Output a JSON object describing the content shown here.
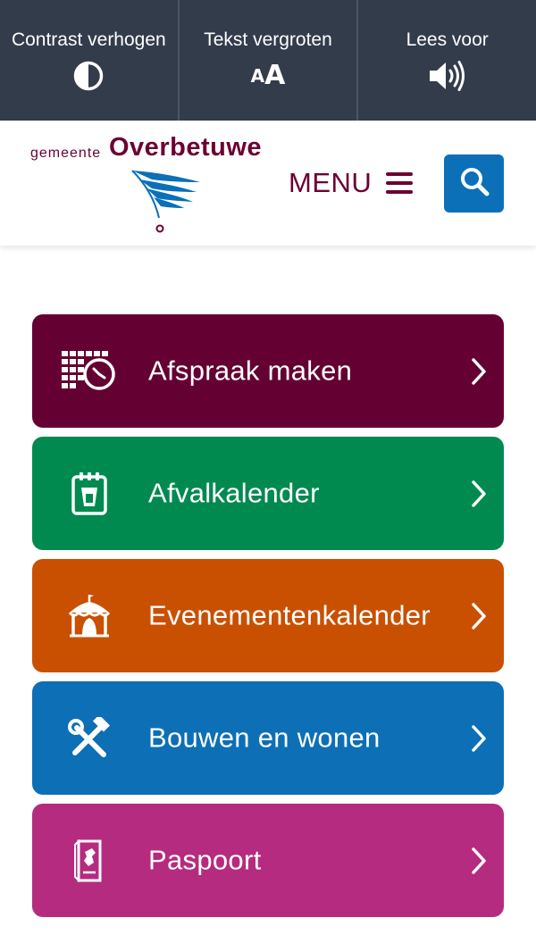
{
  "accessibility_bar": {
    "background": "#333c4b",
    "items": [
      {
        "label": "Contrast verhogen",
        "icon": "contrast-icon"
      },
      {
        "label": "Tekst vergroten",
        "icon": "text-size-icon",
        "icon_text_small": "A",
        "icon_text_big": "A"
      },
      {
        "label": "Lees voor",
        "icon": "speaker-icon"
      }
    ]
  },
  "header": {
    "logo": {
      "small_text": "gemeente",
      "big_text": "Overbetuwe",
      "color": "#6b0033",
      "mark_color": "#0b70b8",
      "icon": "overbetuwe-logo-mark"
    },
    "menu_label": "MENU",
    "menu_icon": "hamburger-icon",
    "search_icon": "search-icon",
    "search_button_color": "#0b70b8"
  },
  "tiles": [
    {
      "label": "Afspraak maken",
      "icon": "calendar-clock-icon",
      "color": "#650032"
    },
    {
      "label": "Afvalkalender",
      "icon": "waste-calendar-icon",
      "color": "#008a50"
    },
    {
      "label": "Evenementenkalender",
      "icon": "event-tent-icon",
      "color": "#c95000"
    },
    {
      "label": "Bouwen en wonen",
      "icon": "hammer-wrench-icon",
      "color": "#0d6fb5"
    },
    {
      "label": "Paspoort",
      "icon": "passport-icon",
      "color": "#b52b7f"
    }
  ]
}
